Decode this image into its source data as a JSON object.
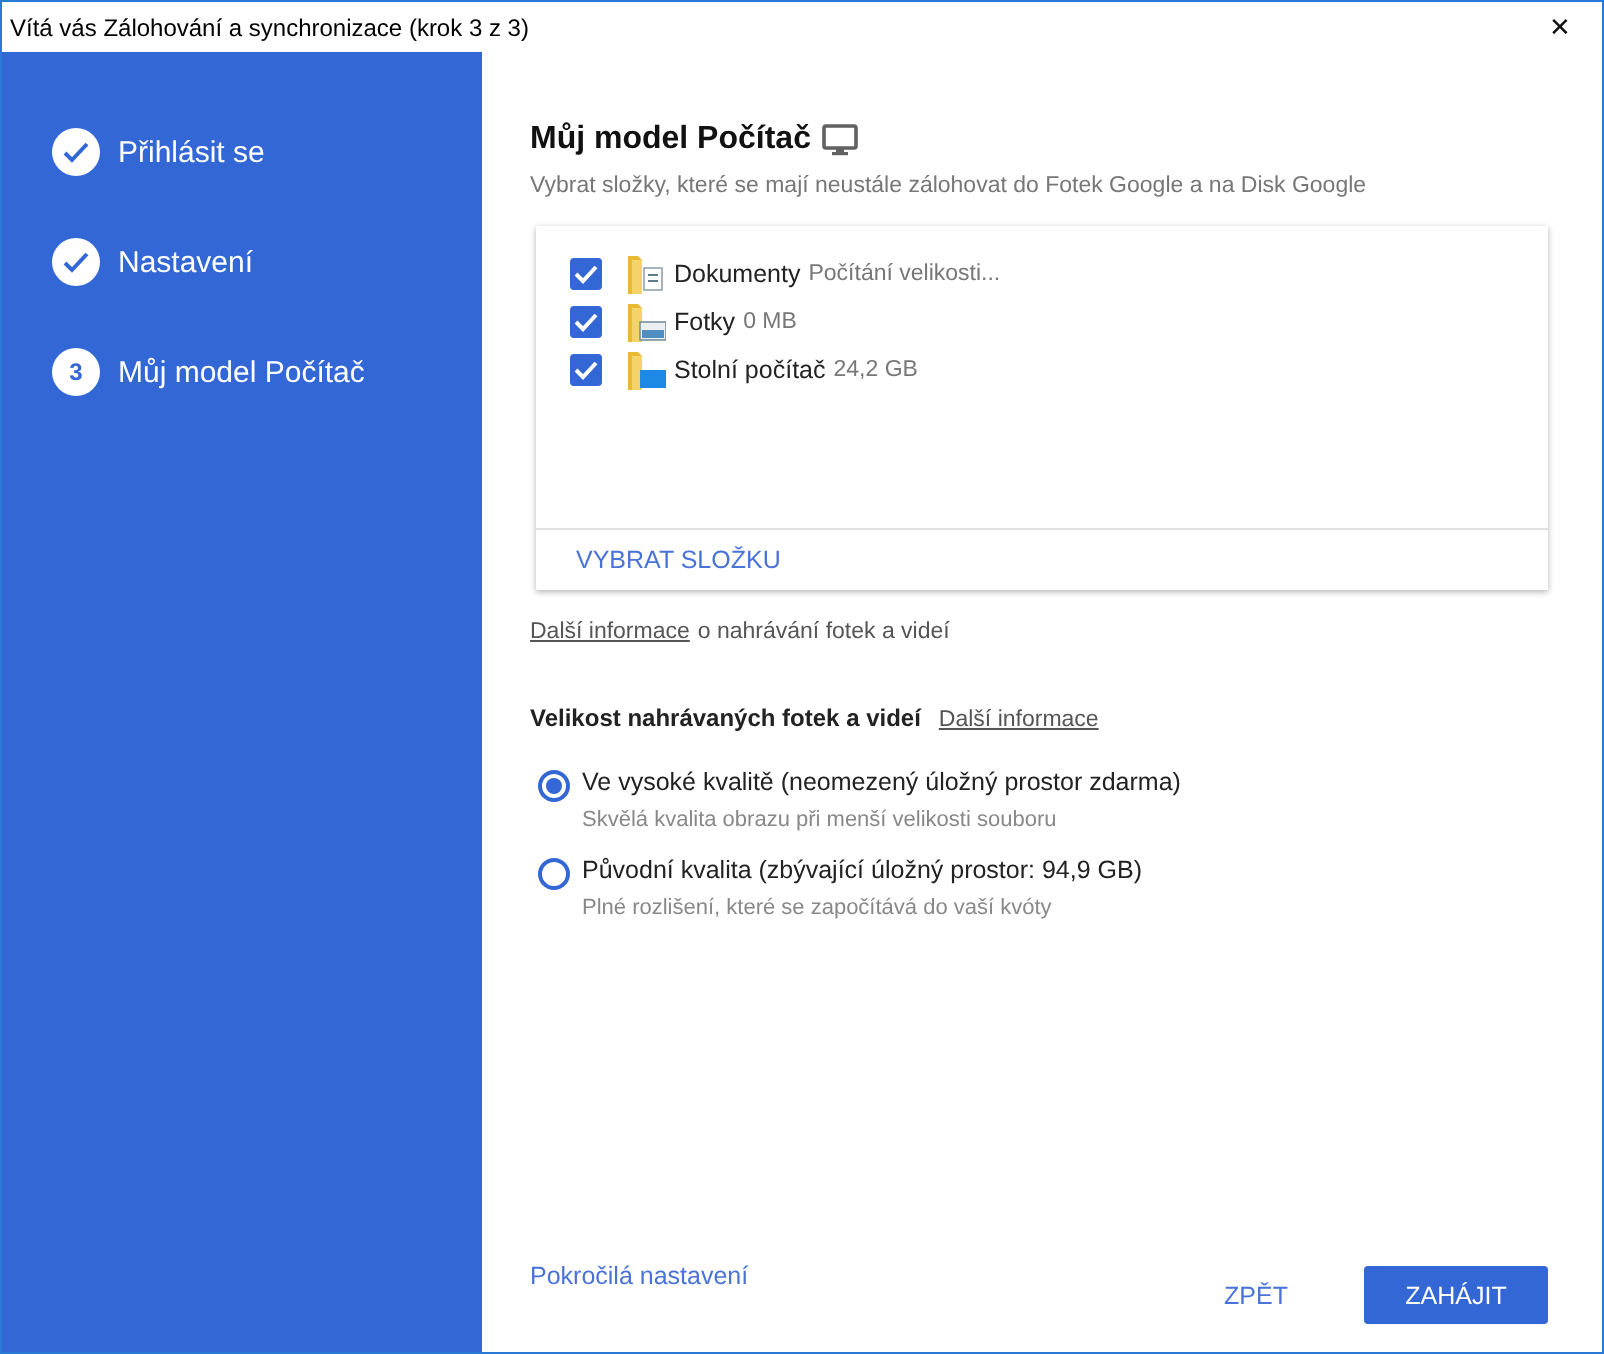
{
  "window": {
    "title": "Vítá vás Zálohování a synchronizace (krok 3 z 3)",
    "close": "✕"
  },
  "steps": [
    {
      "label": "Přihlásit se",
      "done": true
    },
    {
      "label": "Nastavení",
      "done": true
    },
    {
      "label": "Můj model Počítač",
      "done": false,
      "number": "3"
    }
  ],
  "heading": "Můj model Počítač",
  "subtitle": "Vybrat složky, které se mají neustále zálohovat do Fotek Google a na Disk Google",
  "folders": [
    {
      "name": "Dokumenty",
      "size": "Počítání velikosti...",
      "checked": true,
      "kind": "documents"
    },
    {
      "name": "Fotky",
      "size": "0 MB",
      "checked": true,
      "kind": "photos"
    },
    {
      "name": "Stolní počítač",
      "size": "24,2 GB",
      "checked": true,
      "kind": "desktop"
    }
  ],
  "choose_folder": "VYBRAT SLOŽKU",
  "info_line": {
    "link": "Další informace",
    "text": "o nahrávání fotek a videí"
  },
  "size_section": {
    "title": "Velikost nahrávaných fotek a videí",
    "link": "Další informace"
  },
  "options": [
    {
      "label": "Ve vysoké kvalitě (neomezený úložný prostor zdarma)",
      "description": "Skvělá kvalita obrazu při menší velikosti souboru",
      "selected": true
    },
    {
      "label": "Původní kvalita (zbývající úložný prostor: 94,9 GB)",
      "description": "Plné rozlišení, které se započítává do vaší kvóty",
      "selected": false
    }
  ],
  "advanced_link": "Pokročilá nastavení",
  "buttons": [
    {
      "label": "ZPĚT",
      "kind": "flat"
    },
    {
      "label": "ZAHÁJIT",
      "kind": "primary"
    }
  ]
}
